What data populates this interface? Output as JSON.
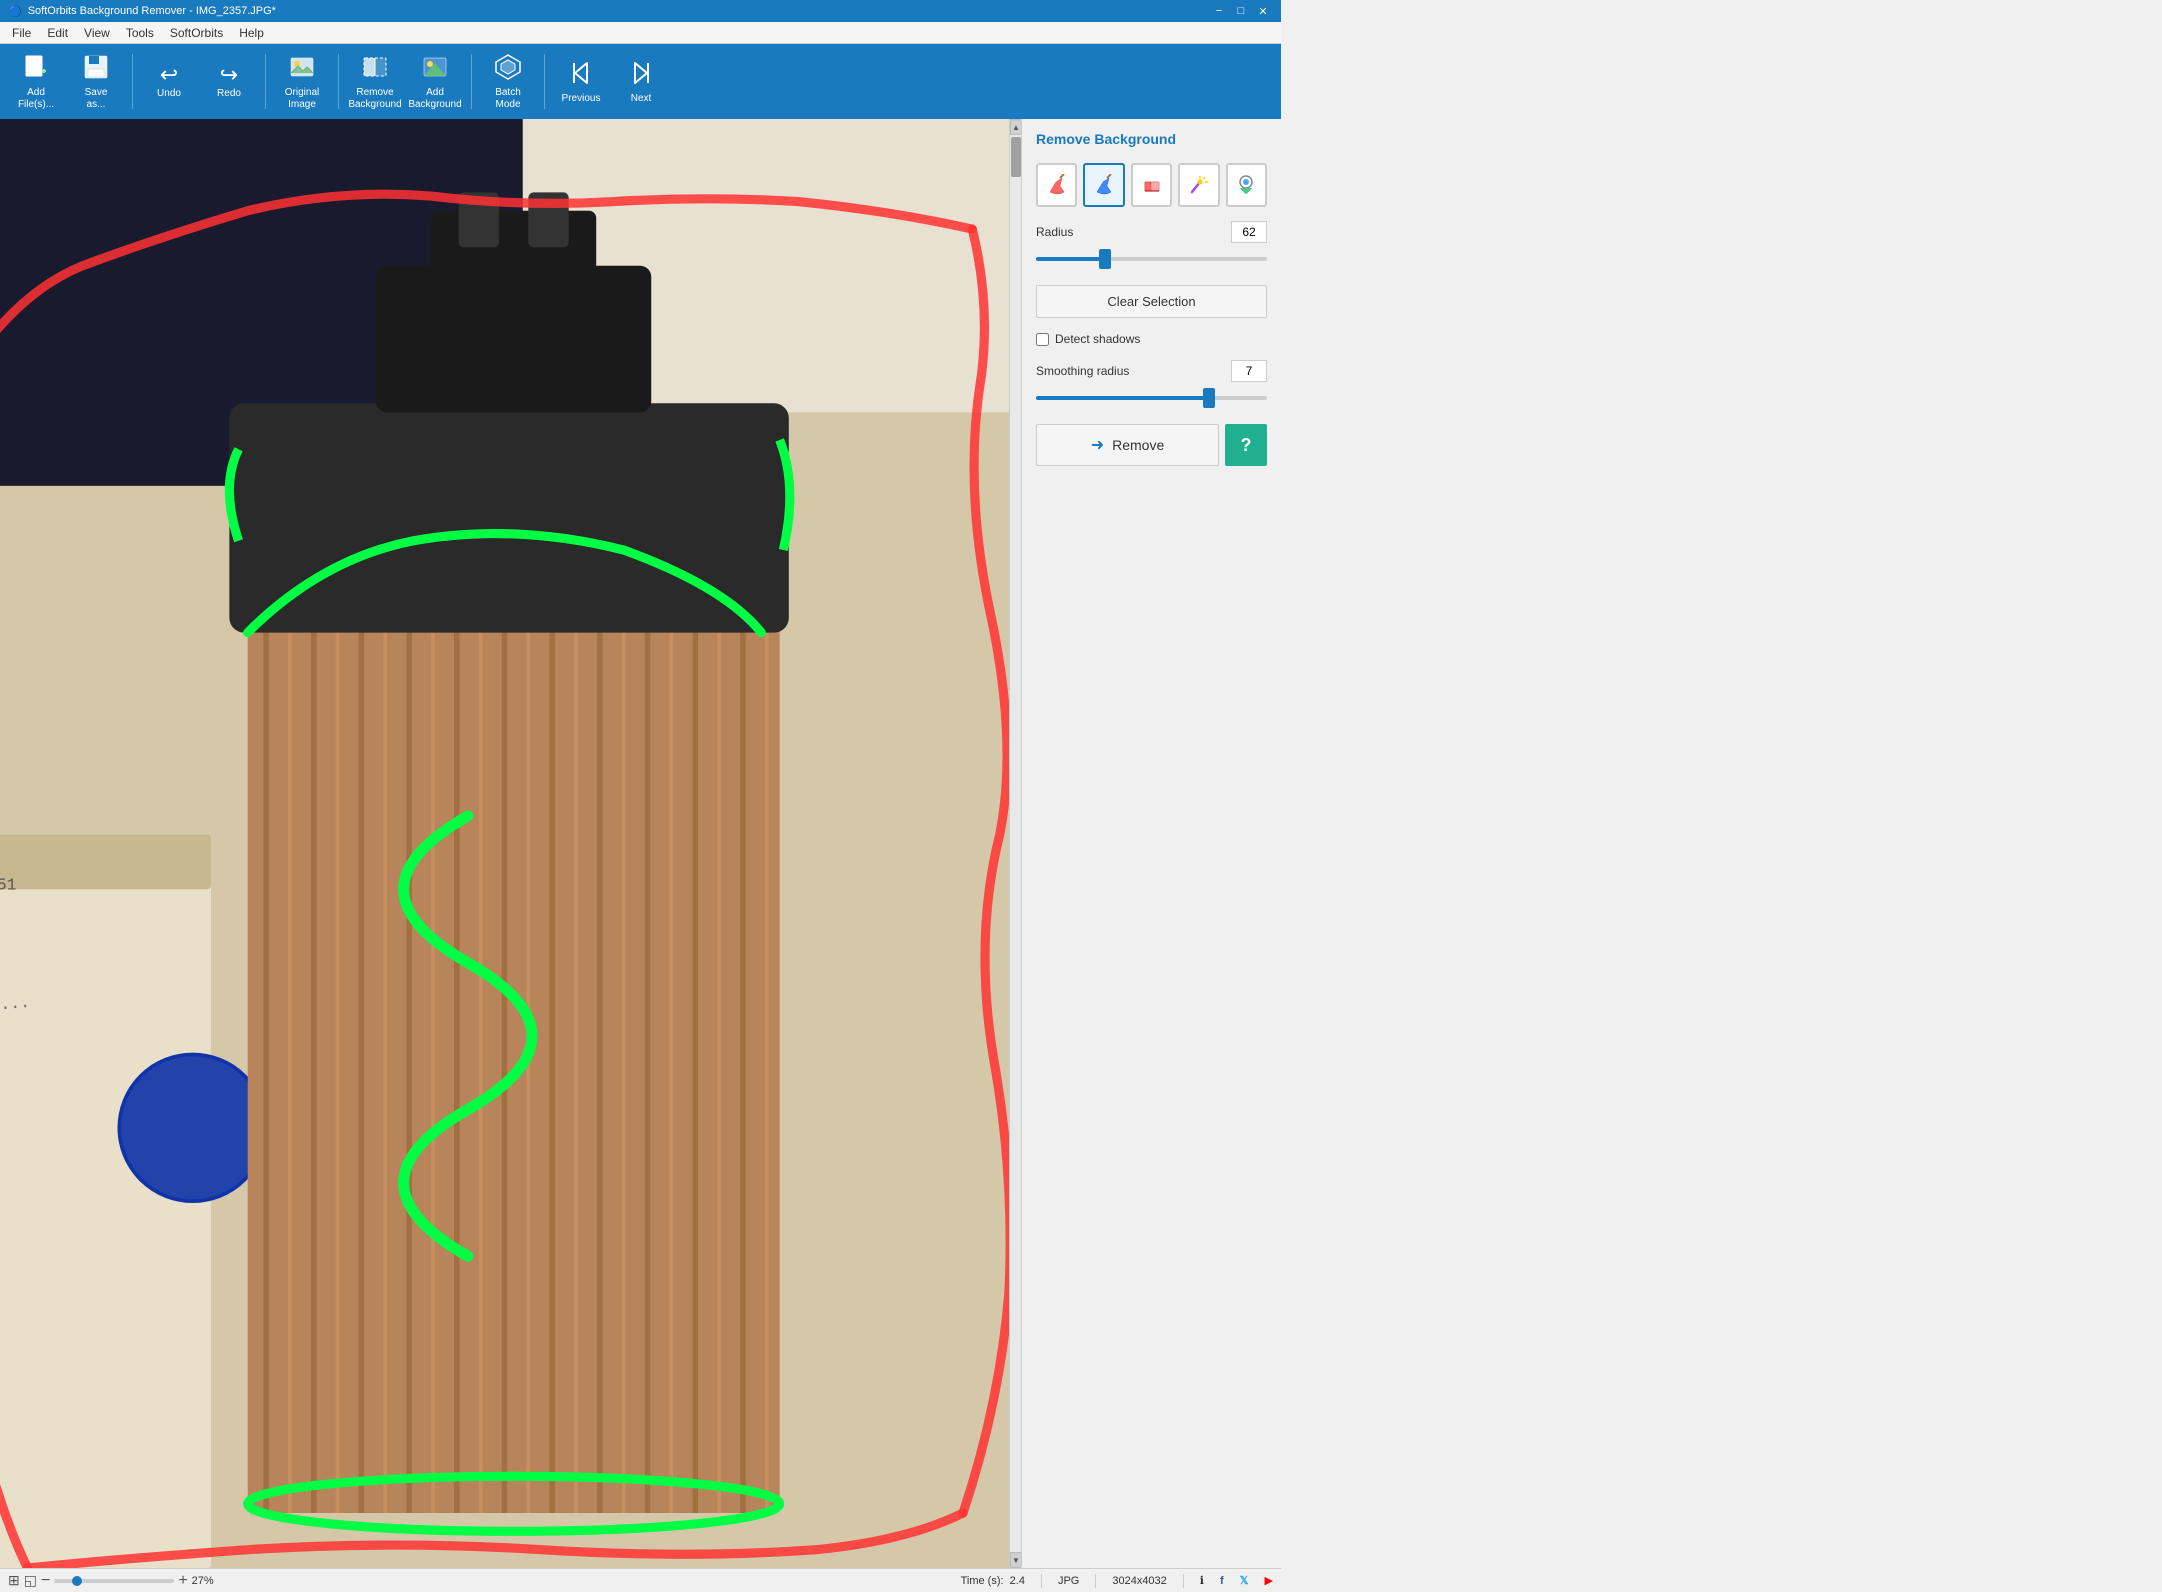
{
  "app": {
    "title": "SoftOrbits Background Remover - IMG_2357.JPG*",
    "icon": "🔵"
  },
  "titlebar": {
    "title": "SoftOrbits Background Remover - IMG_2357.JPG*",
    "minimize": "−",
    "maximize": "□",
    "close": "✕"
  },
  "menubar": {
    "items": [
      "File",
      "Edit",
      "View",
      "Tools",
      "SoftOrbits",
      "Help"
    ]
  },
  "toolbar": {
    "buttons": [
      {
        "id": "add-files",
        "icon": "📄",
        "label": "Add\nFile(s)..."
      },
      {
        "id": "save-as",
        "icon": "💾",
        "label": "Save\nas..."
      },
      {
        "id": "undo",
        "icon": "↩",
        "label": "Undo"
      },
      {
        "id": "redo",
        "icon": "↪",
        "label": "Redo"
      },
      {
        "id": "original-image",
        "icon": "🖼",
        "label": "Original\nImage"
      },
      {
        "id": "remove-background",
        "icon": "✂",
        "label": "Remove\nBackground"
      },
      {
        "id": "add-background",
        "icon": "🏔",
        "label": "Add\nBackground"
      },
      {
        "id": "batch-mode",
        "icon": "⬡",
        "label": "Batch\nMode"
      },
      {
        "id": "previous",
        "icon": "◁",
        "label": "Previous"
      },
      {
        "id": "next",
        "icon": "▷",
        "label": "Next"
      }
    ]
  },
  "right_panel": {
    "title": "Remove Background",
    "tools": [
      {
        "id": "keep-brush",
        "icon": "✏",
        "tooltip": "Keep brush",
        "active": false
      },
      {
        "id": "remove-brush",
        "icon": "🖊",
        "tooltip": "Remove brush",
        "active": true
      },
      {
        "id": "eraser",
        "icon": "⬜",
        "tooltip": "Eraser",
        "active": false
      },
      {
        "id": "magic-wand",
        "icon": "⚡",
        "tooltip": "Magic wand",
        "active": false
      },
      {
        "id": "color-picker",
        "icon": "🎨",
        "tooltip": "Color picker",
        "active": false
      }
    ],
    "radius": {
      "label": "Radius",
      "value": 62,
      "slider_percent": 30
    },
    "clear_selection": {
      "label": "Clear Selection"
    },
    "detect_shadows": {
      "label": "Detect shadows",
      "checked": false
    },
    "smoothing_radius": {
      "label": "Smoothing radius",
      "value": 7,
      "slider_percent": 75
    },
    "remove_button": {
      "label": "Remove",
      "arrow": "➜"
    },
    "help_button": {
      "label": "?"
    }
  },
  "statusbar": {
    "zoom_out": "−",
    "zoom_in": "+",
    "zoom_percent": "27%",
    "time_label": "Time (s):",
    "time_value": "2.4",
    "format": "JPG",
    "dimensions": "3024x4032",
    "icons": [
      "ℹ",
      "📘",
      "🐦",
      "📺"
    ]
  }
}
